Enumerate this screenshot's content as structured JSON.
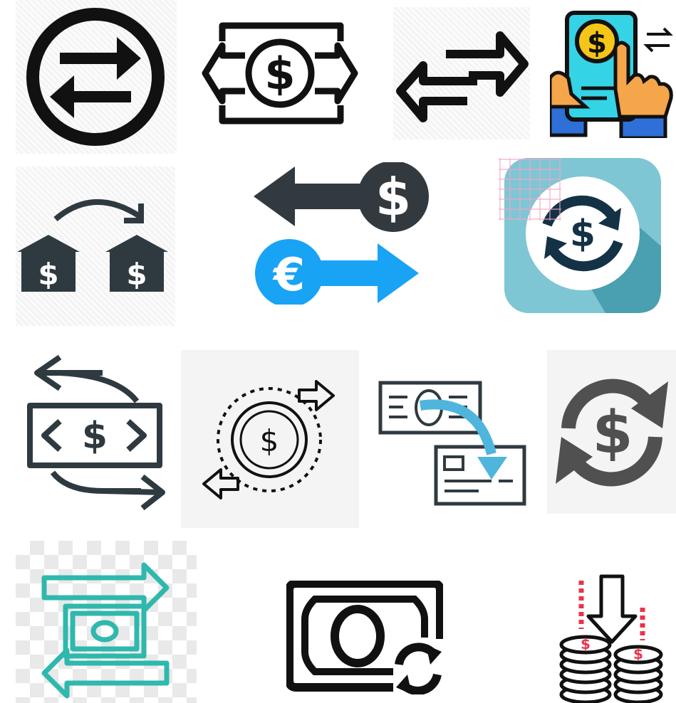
{
  "symbols": {
    "dollar": "$",
    "euro": "€"
  },
  "colors": {
    "black": "#111111",
    "dark": "#2f3a40",
    "blue": "#19a3f5",
    "teal": "#2fb8ad",
    "app_bg": "#7fc6d4",
    "app_shadow": "#4a9fb0",
    "app_navy": "#143246",
    "phone_cyan": "#35d3e6",
    "coin_yellow": "#f5c518",
    "hand_orange": "#f5a54a",
    "coin_red": "#e8344a"
  },
  "icons": [
    "exchange-circle-arrows-icon",
    "banknote-dollar-exchange-icon",
    "left-right-arrows-icon",
    "phone-payment-transfer-icon",
    "bank-to-bank-transfer-icon",
    "dollar-euro-exchange-icon",
    "dollar-refresh-app-icon",
    "banknote-cycle-arrows-icon",
    "coin-exchange-arrows-icon",
    "cheque-to-card-transfer-icon",
    "dollar-refresh-icon",
    "banknote-swap-arrows-icon",
    "banknote-sync-icon",
    "coins-deposit-icon"
  ]
}
